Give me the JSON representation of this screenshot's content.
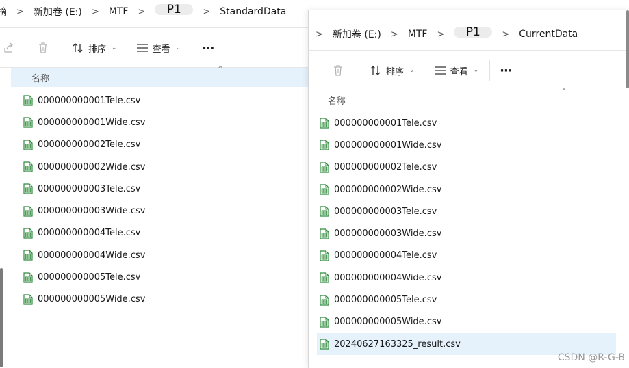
{
  "left_window": {
    "breadcrumb": [
      "摘",
      "新加卷 (E:)",
      "MTF",
      "P1",
      "StandardData"
    ],
    "toolbar": {
      "sort_label": "排序",
      "view_label": "查看",
      "more_label": "···"
    },
    "column_name": "名称",
    "files": [
      "000000000001Tele.csv",
      "000000000001Wide.csv",
      "000000000002Tele.csv",
      "000000000002Wide.csv",
      "000000000003Tele.csv",
      "000000000003Wide.csv",
      "000000000004Tele.csv",
      "000000000004Wide.csv",
      "000000000005Tele.csv",
      "000000000005Wide.csv"
    ]
  },
  "right_window": {
    "breadcrumb": [
      "新加卷 (E:)",
      "MTF",
      "P1",
      "CurrentData"
    ],
    "toolbar": {
      "sort_label": "排序",
      "view_label": "查看",
      "more_label": "···"
    },
    "column_name": "名称",
    "files": [
      "000000000001Tele.csv",
      "000000000001Wide.csv",
      "000000000002Tele.csv",
      "000000000002Wide.csv",
      "000000000003Tele.csv",
      "000000000003Wide.csv",
      "000000000004Tele.csv",
      "000000000004Wide.csv",
      "000000000005Tele.csv",
      "000000000005Wide.csv",
      "20240627163325_result.csv"
    ],
    "selected_file": "20240627163325_result.csv"
  },
  "watermark": "CSDN @R-G-B",
  "colors": {
    "selection": "#e5f1fb",
    "csv_icon": "#2e8b3d"
  },
  "icons": [
    "share-icon",
    "trash-icon",
    "sort-icon",
    "view-icon",
    "more-icon",
    "csv-file-icon",
    "chevron-right-icon",
    "chevron-down-icon"
  ]
}
